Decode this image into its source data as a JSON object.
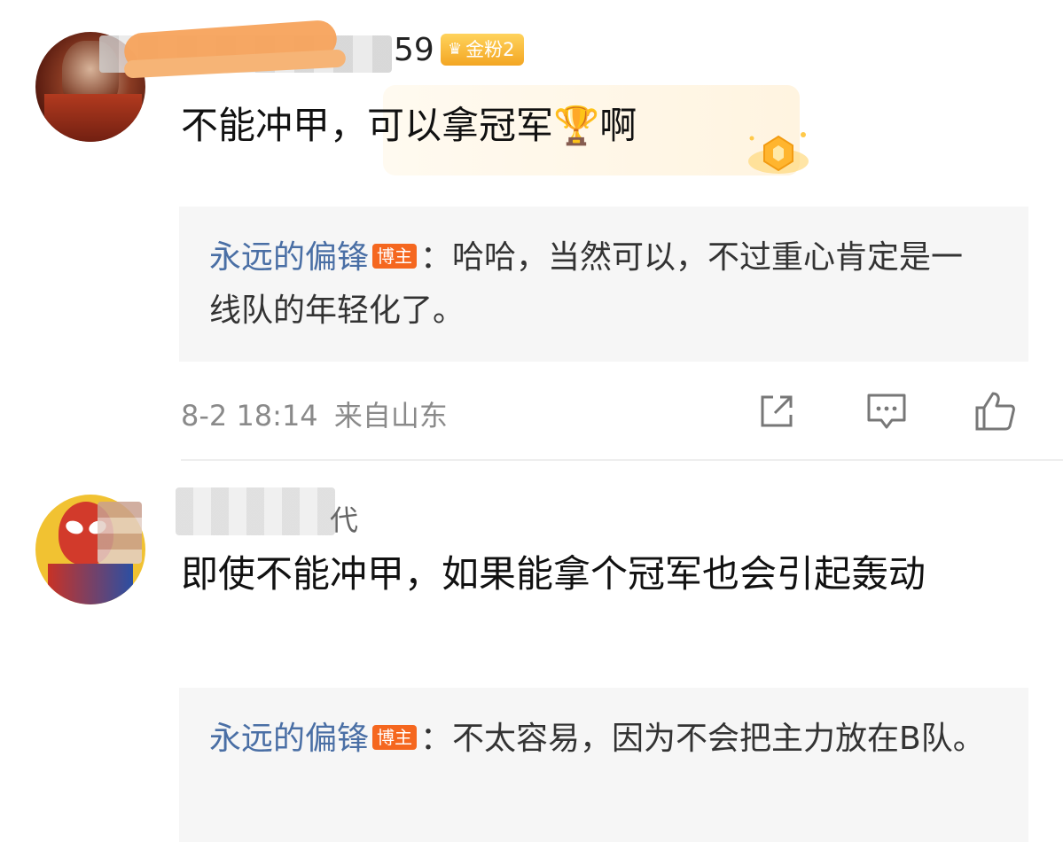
{
  "comments": [
    {
      "username_visible": "59",
      "fan_badge": "金粉2",
      "text": "不能冲甲，可以拿冠军🏆啊",
      "reply": {
        "author": "永远的偏锋",
        "author_badge": "博主",
        "text": "：哈哈，当然可以，不过重心肯定是一线队的年轻化了。"
      },
      "time": "8-2 18:14",
      "location": "来自山东"
    },
    {
      "username_visible": "代",
      "text": "即使不能冲甲，如果能拿个冠军也会引起轰动",
      "reply": {
        "author": "永远的偏锋",
        "author_badge": "博主",
        "text": "：不太容易，因为不会把主力放在B队。"
      }
    }
  ],
  "icons": {
    "forward": "share-icon",
    "comment": "comment-icon",
    "like": "like-icon",
    "fan_badge_icon": "crown-icon",
    "decoration": "medal-icon"
  },
  "colors": {
    "author_blue": "#4a6fa5",
    "owner_badge": "#f5671f",
    "gold_badge": "#f3a623",
    "meta_gray": "#8a8a8a",
    "reply_bg": "#f6f6f6"
  }
}
